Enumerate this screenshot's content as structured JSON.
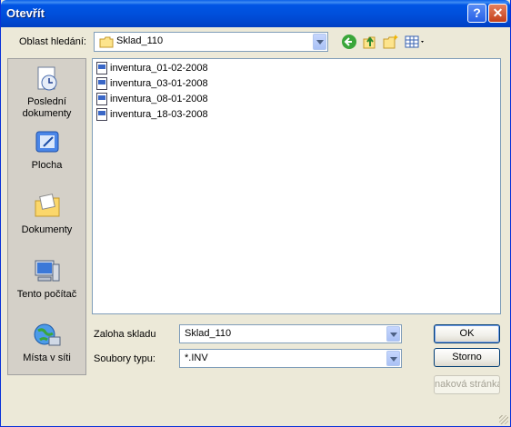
{
  "window": {
    "title": "Otevřít",
    "help": "?",
    "close": "✕"
  },
  "lookin": {
    "label": "Oblast hledání:",
    "value": "Sklad_110"
  },
  "sidebar": [
    {
      "label": "Poslední dokumenty",
      "icon": "recent-documents-icon"
    },
    {
      "label": "Plocha",
      "icon": "desktop-icon"
    },
    {
      "label": "Dokumenty",
      "icon": "documents-folder-icon"
    },
    {
      "label": "Tento počítač",
      "icon": "computer-icon"
    },
    {
      "label": "Místa v síti",
      "icon": "network-places-icon"
    }
  ],
  "files": [
    {
      "name": "inventura_01-02-2008"
    },
    {
      "name": "inventura_03-01-2008"
    },
    {
      "name": "inventura_08-01-2008"
    },
    {
      "name": "inventura_18-03-2008"
    }
  ],
  "filename": {
    "label": "Zaloha skladu",
    "value": "Sklad_110"
  },
  "filetype": {
    "label": "Soubory typu:",
    "value": "*.INV"
  },
  "buttons": {
    "ok": "OK",
    "cancel": "Storno",
    "help": "naková stránka"
  }
}
